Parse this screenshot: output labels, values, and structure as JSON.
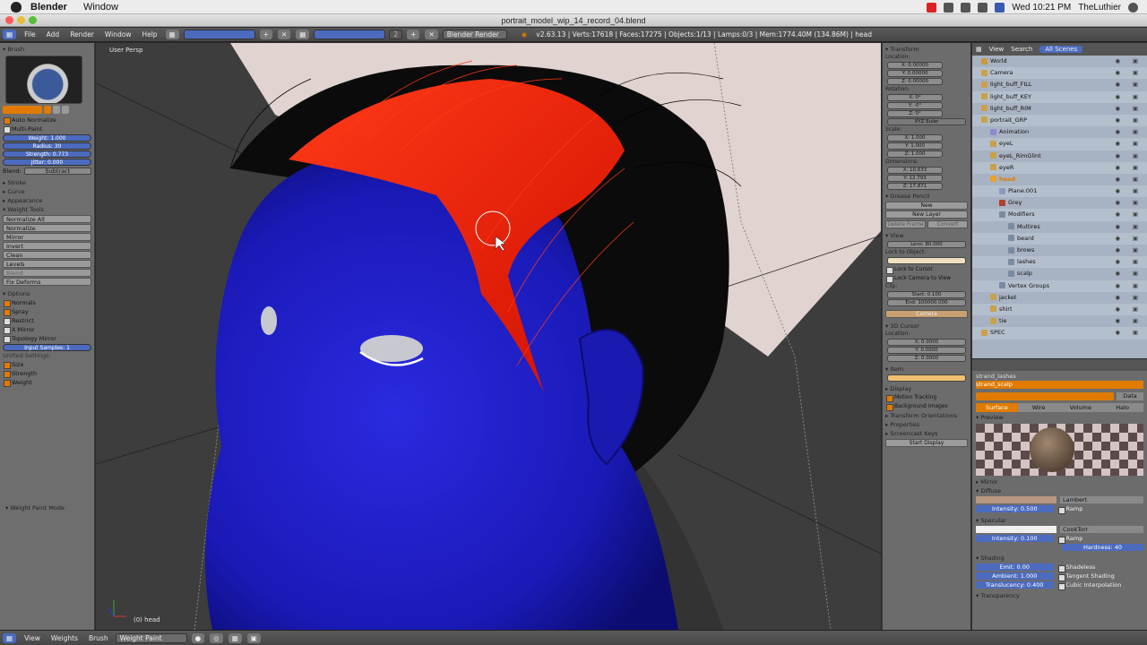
{
  "macbar": {
    "app_name": "Blender",
    "menus": [
      "Window"
    ],
    "clock": "Wed 10:21 PM",
    "user": "TheLuthier"
  },
  "window": {
    "title": "portrait_model_wip_14_record_04.blend"
  },
  "infobar": {
    "menus": [
      "File",
      "Add",
      "Render",
      "Window",
      "Help"
    ],
    "engine": "Blender Render",
    "scene_count": "2",
    "stats": "v2.63.13 | Verts:17618 | Faces:17275 | Objects:1/13 | Lamps:0/3 | Mem:1774.40M (134.86M) | head"
  },
  "toolshelf": {
    "brush_header": "Brush",
    "auto_normalize": "Auto Normalize",
    "multi_paint": "Multi-Paint",
    "weight": "Weight: 1.000",
    "radius": "Radius: 30",
    "strength": "Strength: 0.773",
    "jitter": "Jitter: 0.000",
    "blend_label": "Blend:",
    "blend_value": "Subtract",
    "collapsed": [
      "Stroke",
      "Curve",
      "Appearance"
    ],
    "weight_tools_header": "Weight Tools",
    "weight_tools": [
      "Normalize All",
      "Normalize",
      "Mirror",
      "Invert",
      "Clean",
      "Levels",
      "Blend",
      "Fix Deforms"
    ],
    "options_header": "Options",
    "options": [
      {
        "label": "Normals",
        "on": true
      },
      {
        "label": "Spray",
        "on": true
      },
      {
        "label": "Restrict",
        "on": false
      },
      {
        "label": "X Mirror",
        "on": false
      },
      {
        "label": "Topology Mirror",
        "on": false
      }
    ],
    "input_samples": "Input Samples: 1",
    "unified_label": "Unified Settings:",
    "unified": [
      {
        "label": "Size",
        "on": true
      },
      {
        "label": "Strength",
        "on": true
      },
      {
        "label": "Weight",
        "on": true
      }
    ],
    "mode_panel": "Weight Paint Mode"
  },
  "viewport": {
    "view_label": "User Persp",
    "object_label": "(0) head"
  },
  "npanel": {
    "transform_header": "Transform",
    "location_label": "Location:",
    "location": [
      "X: 0.00000",
      "Y: 0.00000",
      "Z: 0.00000"
    ],
    "rotation_label": "Rotation:",
    "rotation": [
      "X: 0°",
      "Y: -0°",
      "Z: 0°"
    ],
    "rotation_mode": "XYZ Euler",
    "scale_label": "Scale:",
    "scale": [
      "X: 1.000",
      "Y: 1.000",
      "Z: 1.000"
    ],
    "dimensions_label": "Dimensions:",
    "dimensions": [
      "X: 10.633",
      "Y: 12.793",
      "Z: 17.871"
    ],
    "grease_header": "Grease Pencil",
    "grease_new": "New",
    "new_layer": "New Layer",
    "delete_frame": "Delete Frame",
    "convert": "Convert",
    "view_header": "View",
    "lens": "Lens: 80.000",
    "lock_to_object": "Lock to Object:",
    "lock_to_cursor": "Lock to Cursor",
    "lock_camera": "Lock Camera to View",
    "clip_label": "Clip:",
    "clip_start": "Start: 0.100",
    "clip_end": "End: 100000.000",
    "camera": "Camera",
    "cursor_header": "3D Cursor",
    "cursor_location_label": "Location:",
    "cursor_location": [
      "X: 0.0000",
      "Y: 0.0000",
      "Z: 0.0000"
    ],
    "item_header": "Item",
    "closed_panels": [
      "Display",
      "Motion Tracking",
      "Background Images",
      "Transform Orientations",
      "Properties",
      "Screencast Keys"
    ],
    "start_display": "Start Display"
  },
  "outliner": {
    "header": [
      "View",
      "Search",
      "All Scenes"
    ],
    "rows": [
      {
        "label": "World",
        "indent": 1,
        "color": "#c99a3a"
      },
      {
        "label": "Camera",
        "indent": 1,
        "color": "#caa14a"
      },
      {
        "label": "light_buff_FILL",
        "indent": 1,
        "color": "#caa14a"
      },
      {
        "label": "light_buff_KEY",
        "indent": 1,
        "color": "#caa14a"
      },
      {
        "label": "light_buff_RIM",
        "indent": 1,
        "color": "#caa14a"
      },
      {
        "label": "portrait_GRP",
        "indent": 1,
        "color": "#caa14a"
      },
      {
        "label": "Animation",
        "indent": 2,
        "color": "#8a8ad0"
      },
      {
        "label": "eyeL",
        "indent": 2,
        "color": "#caa14a"
      },
      {
        "label": "eyeL_RimGlint",
        "indent": 2,
        "color": "#caa14a"
      },
      {
        "label": "eyeR",
        "indent": 2,
        "color": "#caa14a"
      },
      {
        "label": "head",
        "indent": 2,
        "color": "#e8a030"
      },
      {
        "label": "Plane.001",
        "indent": 3,
        "color": "#8a9ac0"
      },
      {
        "label": "Grey",
        "indent": 3,
        "color": "#b04030"
      },
      {
        "label": "Modifiers",
        "indent": 3,
        "color": "#7a8aa0"
      },
      {
        "label": "Multires",
        "indent": 4,
        "color": "#7a8aa0"
      },
      {
        "label": "beard",
        "indent": 4,
        "color": "#7a8aa0"
      },
      {
        "label": "brows",
        "indent": 4,
        "color": "#7a8aa0"
      },
      {
        "label": "lashes",
        "indent": 4,
        "color": "#7a8aa0"
      },
      {
        "label": "scalp",
        "indent": 4,
        "color": "#7a8aa0"
      },
      {
        "label": "Vertex Groups",
        "indent": 3,
        "color": "#7a8aa0"
      },
      {
        "label": "jacket",
        "indent": 2,
        "color": "#caa14a"
      },
      {
        "label": "shirt",
        "indent": 2,
        "color": "#caa14a"
      },
      {
        "label": "tie",
        "indent": 2,
        "color": "#caa14a"
      },
      {
        "label": "SPEC",
        "indent": 1,
        "color": "#caa14a"
      }
    ]
  },
  "props": {
    "slots": [
      "strand_lashes",
      "strand_scalp"
    ],
    "data_label": "Data",
    "tabs": [
      "Surface",
      "Wire",
      "Volume",
      "Halo"
    ],
    "preview": "Preview",
    "mirror": "Mirror",
    "diffuse": "Diffuse",
    "diffuse_shader": "Lambert",
    "diffuse_intensity": "Intensity: 0.500",
    "ramp": "Ramp",
    "specular": "Specular",
    "spec_shader": "CookTorr",
    "spec_intensity": "Intensity: 0.100",
    "hardness": "Hardness: 40",
    "shading": "Shading",
    "emit": "Emit: 0.00",
    "ambient": "Ambient: 1.000",
    "translucency": "Translucency: 0.400",
    "shadeless": "Shadeless",
    "tangent": "Tangent Shading",
    "cubic": "Cubic Interpolation",
    "transparency": "Transparency"
  },
  "bottombar": {
    "menus": [
      "View",
      "Weights",
      "Brush"
    ],
    "mode": "Weight Paint"
  },
  "colors": {
    "weight_blue": "#1f20c8",
    "weight_red": "#ff2a10",
    "accent_orange": "#e07b00",
    "selection_blue": "#4c6bbf"
  }
}
